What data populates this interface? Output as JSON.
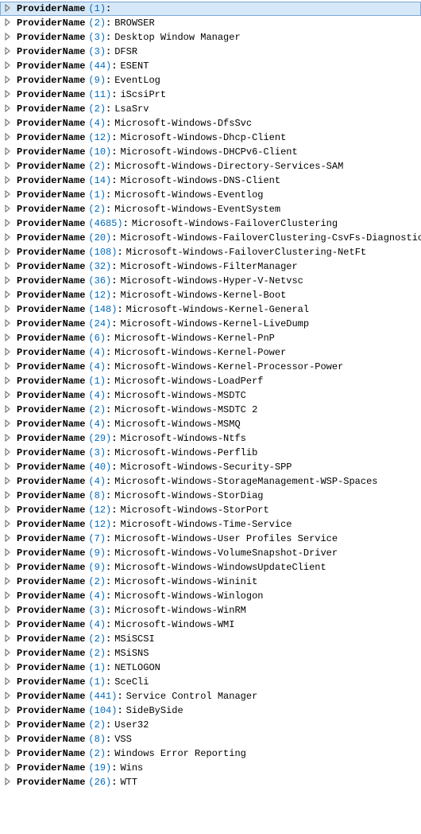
{
  "field_label": "ProviderName",
  "rows": [
    {
      "count": 1,
      "value": "",
      "selected": true
    },
    {
      "count": 2,
      "value": "BROWSER"
    },
    {
      "count": 3,
      "value": "Desktop Window Manager"
    },
    {
      "count": 3,
      "value": "DFSR"
    },
    {
      "count": 44,
      "value": "ESENT"
    },
    {
      "count": 9,
      "value": "EventLog"
    },
    {
      "count": 11,
      "value": "iScsiPrt"
    },
    {
      "count": 2,
      "value": "LsaSrv"
    },
    {
      "count": 4,
      "value": "Microsoft-Windows-DfsSvc"
    },
    {
      "count": 12,
      "value": "Microsoft-Windows-Dhcp-Client"
    },
    {
      "count": 10,
      "value": "Microsoft-Windows-DHCPv6-Client"
    },
    {
      "count": 2,
      "value": "Microsoft-Windows-Directory-Services-SAM"
    },
    {
      "count": 14,
      "value": "Microsoft-Windows-DNS-Client"
    },
    {
      "count": 1,
      "value": "Microsoft-Windows-Eventlog"
    },
    {
      "count": 2,
      "value": "Microsoft-Windows-EventSystem"
    },
    {
      "count": 4685,
      "value": "Microsoft-Windows-FailoverClustering"
    },
    {
      "count": 20,
      "value": "Microsoft-Windows-FailoverClustering-CsvFs-Diagnostic"
    },
    {
      "count": 108,
      "value": "Microsoft-Windows-FailoverClustering-NetFt"
    },
    {
      "count": 32,
      "value": "Microsoft-Windows-FilterManager"
    },
    {
      "count": 36,
      "value": "Microsoft-Windows-Hyper-V-Netvsc"
    },
    {
      "count": 12,
      "value": "Microsoft-Windows-Kernel-Boot"
    },
    {
      "count": 148,
      "value": "Microsoft-Windows-Kernel-General"
    },
    {
      "count": 24,
      "value": "Microsoft-Windows-Kernel-LiveDump"
    },
    {
      "count": 6,
      "value": "Microsoft-Windows-Kernel-PnP"
    },
    {
      "count": 4,
      "value": "Microsoft-Windows-Kernel-Power"
    },
    {
      "count": 4,
      "value": "Microsoft-Windows-Kernel-Processor-Power"
    },
    {
      "count": 1,
      "value": "Microsoft-Windows-LoadPerf"
    },
    {
      "count": 4,
      "value": "Microsoft-Windows-MSDTC"
    },
    {
      "count": 2,
      "value": "Microsoft-Windows-MSDTC 2"
    },
    {
      "count": 4,
      "value": "Microsoft-Windows-MSMQ"
    },
    {
      "count": 29,
      "value": "Microsoft-Windows-Ntfs"
    },
    {
      "count": 3,
      "value": "Microsoft-Windows-Perflib"
    },
    {
      "count": 40,
      "value": "Microsoft-Windows-Security-SPP"
    },
    {
      "count": 4,
      "value": "Microsoft-Windows-StorageManagement-WSP-Spaces"
    },
    {
      "count": 8,
      "value": "Microsoft-Windows-StorDiag"
    },
    {
      "count": 12,
      "value": "Microsoft-Windows-StorPort"
    },
    {
      "count": 12,
      "value": "Microsoft-Windows-Time-Service"
    },
    {
      "count": 7,
      "value": "Microsoft-Windows-User Profiles Service"
    },
    {
      "count": 9,
      "value": "Microsoft-Windows-VolumeSnapshot-Driver"
    },
    {
      "count": 9,
      "value": "Microsoft-Windows-WindowsUpdateClient"
    },
    {
      "count": 2,
      "value": "Microsoft-Windows-Wininit"
    },
    {
      "count": 4,
      "value": "Microsoft-Windows-Winlogon"
    },
    {
      "count": 3,
      "value": "Microsoft-Windows-WinRM"
    },
    {
      "count": 4,
      "value": "Microsoft-Windows-WMI"
    },
    {
      "count": 2,
      "value": "MSiSCSI"
    },
    {
      "count": 2,
      "value": "MSiSNS"
    },
    {
      "count": 1,
      "value": "NETLOGON"
    },
    {
      "count": 1,
      "value": "SceCli"
    },
    {
      "count": 441,
      "value": "Service Control Manager"
    },
    {
      "count": 104,
      "value": "SideBySide"
    },
    {
      "count": 2,
      "value": "User32"
    },
    {
      "count": 8,
      "value": "VSS"
    },
    {
      "count": 2,
      "value": "Windows Error Reporting"
    },
    {
      "count": 19,
      "value": "Wins"
    },
    {
      "count": 26,
      "value": "WTT"
    }
  ]
}
